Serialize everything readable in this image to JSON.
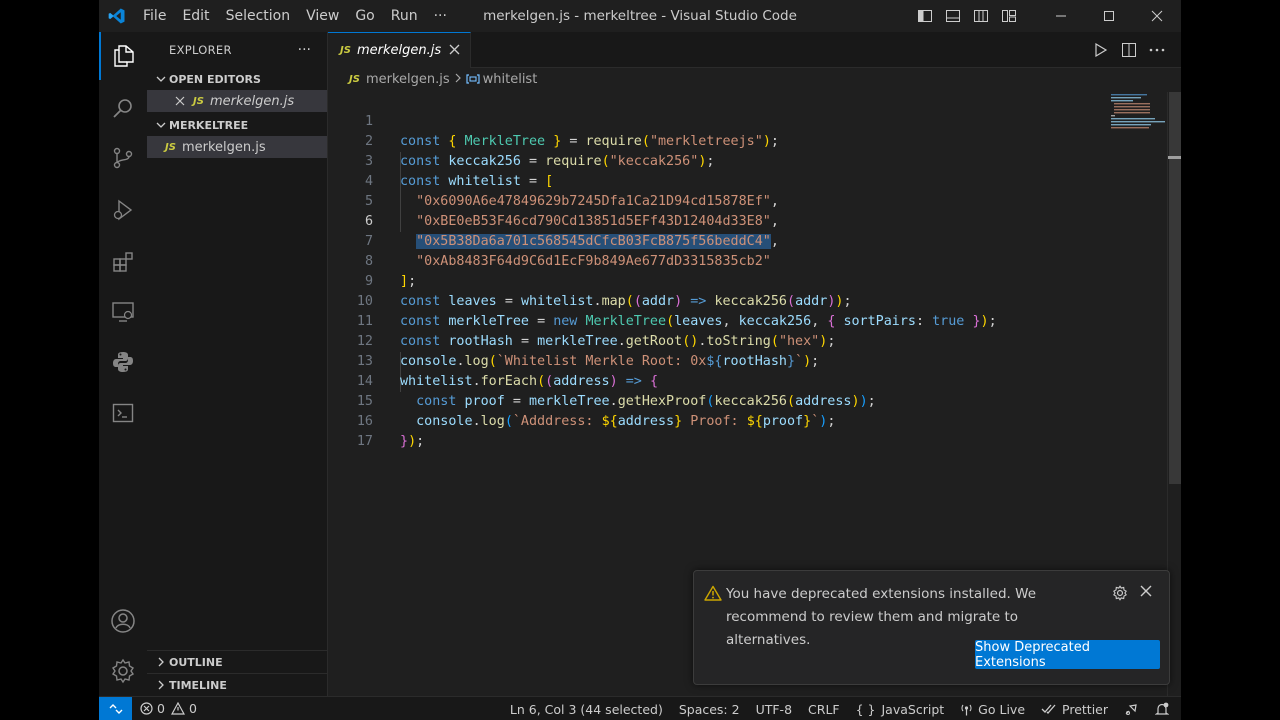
{
  "titlebar": {
    "menus": [
      "File",
      "Edit",
      "Selection",
      "View",
      "Go",
      "Run",
      "···"
    ],
    "title": "merkelgen.js - merkeltree - Visual Studio Code"
  },
  "sidebar": {
    "title": "EXPLORER",
    "more": "···",
    "open_editors": {
      "label": "OPEN EDITORS",
      "files": [
        {
          "badge": "JS",
          "name": "merkelgen.js"
        }
      ]
    },
    "folder": {
      "label": "MERKELTREE",
      "files": [
        {
          "badge": "JS",
          "name": "merkelgen.js"
        }
      ]
    },
    "outline_label": "OUTLINE",
    "timeline_label": "TIMELINE"
  },
  "tab": {
    "badge": "JS",
    "label": "merkelgen.js"
  },
  "breadcrumb": {
    "badge": "JS",
    "file": "merkelgen.js",
    "symbol": "whitelist"
  },
  "code": {
    "line_numbers": [
      "1",
      "2",
      "3",
      "4",
      "5",
      "6",
      "7",
      "8",
      "9",
      "10",
      "11",
      "12",
      "13",
      "14",
      "15",
      "16",
      "17"
    ],
    "current_line": 6,
    "l1": {
      "a": "const",
      "b": "{",
      "c": "MerkleTree",
      "d": "}",
      "e": "=",
      "f": "require",
      "g": "(",
      "h": "\"merkletreejs\"",
      "i": ")",
      "j": ";"
    },
    "l2": {
      "a": "const",
      "b": "keccak256",
      "c": "=",
      "d": "require",
      "e": "(",
      "f": "\"keccak256\"",
      "g": ")",
      "h": ";"
    },
    "l3": {
      "a": "const",
      "b": "whitelist",
      "c": "=",
      "d": "["
    },
    "l4": {
      "s": "\"0x6090A6e47849629b7245Dfa1Ca21D94cd15878Ef\"",
      "p": ","
    },
    "l5": {
      "s": "\"0xBE0eB53F46cd790Cd13851d5EFf43D12404d33E8\"",
      "p": ","
    },
    "l6": {
      "s": "\"0x5B38Da6a701c568545dCfcB03FcB875f56beddC4\"",
      "p": ","
    },
    "l7": {
      "s": "\"0xAb8483F64d9C6d1EcF9b849Ae677dD3315835cb2\""
    },
    "l8": {
      "a": "]",
      "b": ";"
    },
    "l9": {
      "a": "const",
      "b": "leaves",
      "c": "=",
      "d": "whitelist",
      "e": ".",
      "f": "map",
      "g": "(",
      "h": "(",
      "i": "addr",
      "j": ")",
      "k": "=>",
      "l": "keccak256",
      "m": "(",
      "n": "addr",
      "o": ")",
      "p": ")",
      "q": ";"
    },
    "l10": {
      "a": "const",
      "b": "merkleTree",
      "c": "=",
      "d": "new",
      "e": "MerkleTree",
      "f": "(",
      "g": "leaves",
      "h": ",",
      "i": "keccak256",
      "j": ",",
      "k": "{",
      "l": "sortPairs",
      "m": ":",
      "n": "true",
      "o": "}",
      "p": ")",
      "q": ";"
    },
    "l11": {
      "a": "const",
      "b": "rootHash",
      "c": "=",
      "d": "merkleTree",
      "e": ".",
      "f": "getRoot",
      "g": "()",
      "h": ".",
      "i": "toString",
      "j": "(",
      "k": "\"hex\"",
      "l": ")",
      "m": ";"
    },
    "l12": {
      "a": "console",
      "b": ".",
      "c": "log",
      "d": "(",
      "e": "`Whitelist Merkle Root: 0x",
      "f": "${",
      "g": "rootHash",
      "h": "}",
      "i": "`",
      "j": ")",
      "k": ";"
    },
    "l13": {
      "a": "whitelist",
      "b": ".",
      "c": "forEach",
      "d": "(",
      "e": "(",
      "f": "address",
      "g": ")",
      "h": "=>",
      "i": "{"
    },
    "l14": {
      "a": "const",
      "b": "proof",
      "c": "=",
      "d": "merkleTree",
      "e": ".",
      "f": "getHexProof",
      "g": "(",
      "h": "keccak256",
      "i": "(",
      "j": "address",
      "k": ")",
      "l": ")",
      "m": ";"
    },
    "l15": {
      "a": "console",
      "b": ".",
      "c": "log",
      "d": "(",
      "e": "`Adddress: ",
      "f": "${",
      "g": "address",
      "h": "}",
      "i": " Proof: ",
      "j": "${",
      "k": "proof",
      "l": "}",
      "m": "`",
      "n": ")",
      "o": ";"
    },
    "l16": {
      "a": "}",
      "b": ")",
      "c": ";"
    }
  },
  "notification": {
    "message": "You have deprecated extensions installed. We recommend to review them and migrate to alternatives.",
    "button": "Show Deprecated Extensions"
  },
  "statusbar": {
    "errors": "0",
    "warnings": "0",
    "cursor": "Ln 6, Col 3 (44 selected)",
    "spaces": "Spaces: 2",
    "encoding": "UTF-8",
    "eol": "CRLF",
    "language_braces": "{ }",
    "language": "JavaScript",
    "go_live": "Go Live",
    "prettier": "Prettier"
  },
  "colors": {
    "accent": "#0078d4",
    "keyword": "#569cd6",
    "variable": "#9cdcfe",
    "string": "#ce9178",
    "function": "#dcdcaa",
    "class": "#4ec9b0",
    "warning": "#cca700"
  }
}
